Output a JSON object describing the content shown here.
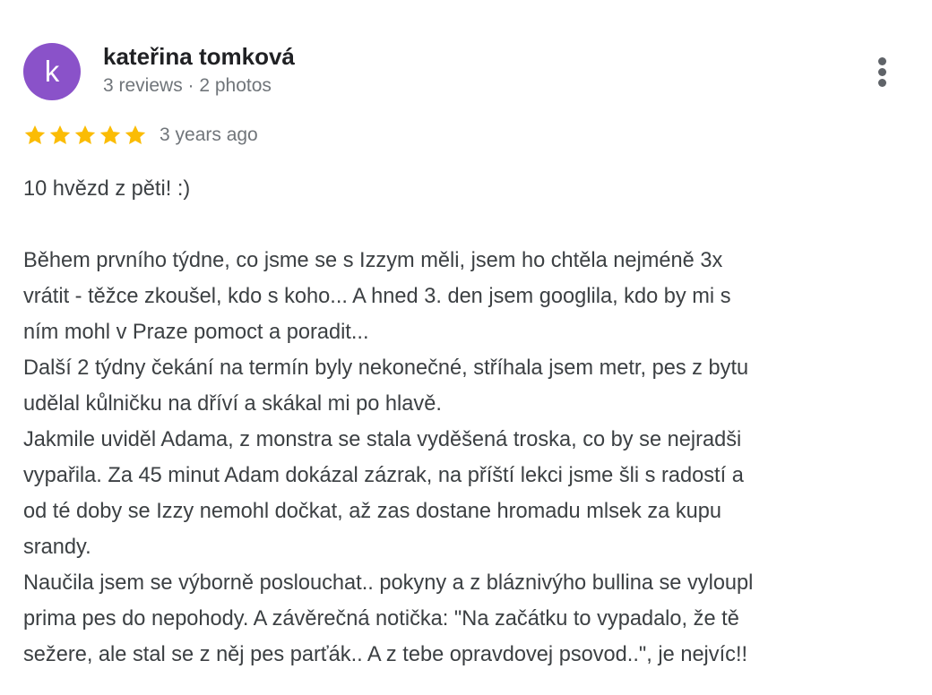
{
  "author": {
    "avatar_letter": "k",
    "avatar_color": "#8a52c9",
    "name": "kateřina tomková",
    "meta": "3 reviews · 2 photos"
  },
  "menu_icon": "more-vert-icon",
  "rating": {
    "stars": 5,
    "max": 5,
    "star_color": "#fbbc04",
    "date": "3 years ago"
  },
  "review": {
    "lines": [
      "10 hvězd z pěti! :)",
      "",
      "Během prvního týdne, co jsme se s Izzym měli, jsem ho chtěla nejméně 3x",
      "vrátit - těžce zkoušel, kdo s koho... A hned 3. den jsem googlila, kdo by mi s",
      "ním mohl v Praze pomoct a poradit...",
      "Další 2 týdny čekání na termín byly nekonečné, stříhala jsem metr, pes z bytu",
      "udělal kůlničku na dříví a skákal mi po hlavě.",
      "Jakmile uviděl Adama, z monstra se stala vyděšená troska, co by se nejradši",
      "vypařila. Za 45 minut Adam dokázal zázrak, na příští lekci jsme šli s radostí a",
      "od té doby se Izzy nemohl dočkat, až zas dostane hromadu mlsek za kupu",
      "srandy.",
      "Naučila jsem se výborně poslouchat.. pokyny a z bláznivýho bullina se vyloupl",
      "prima pes do nepohody. A závěrečná notička: \"Na začátku to vypadalo, že tě",
      "sežere, ale stal se z něj pes parťák.. A z tebe opravdovej psovod..\", je nejvíc!!"
    ]
  }
}
